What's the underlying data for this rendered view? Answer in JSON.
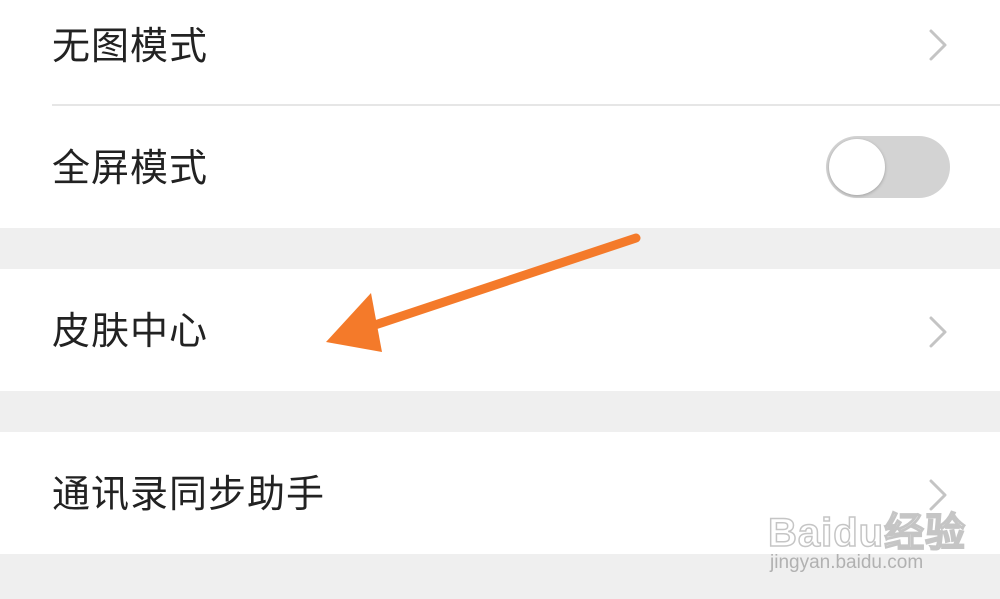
{
  "settings": {
    "items": [
      {
        "label": "无图模式",
        "control": "chevron-right-icon"
      },
      {
        "label": "全屏模式",
        "control": "toggle",
        "toggle_on": false
      },
      {
        "label": "皮肤中心",
        "control": "chevron-right-icon"
      },
      {
        "label": "通讯录同步助手",
        "control": "chevron-right-icon"
      }
    ]
  },
  "annotation": {
    "icon": "arrow-icon",
    "color": "#f47a2a"
  },
  "colors": {
    "background": "#efefef",
    "row": "#ffffff",
    "text": "#222222",
    "chevron": "#c4c4c4",
    "toggle_off": "#d3d3d3"
  },
  "watermark": {
    "brand": "Baidu经验",
    "url": "jingyan.baidu.com"
  }
}
